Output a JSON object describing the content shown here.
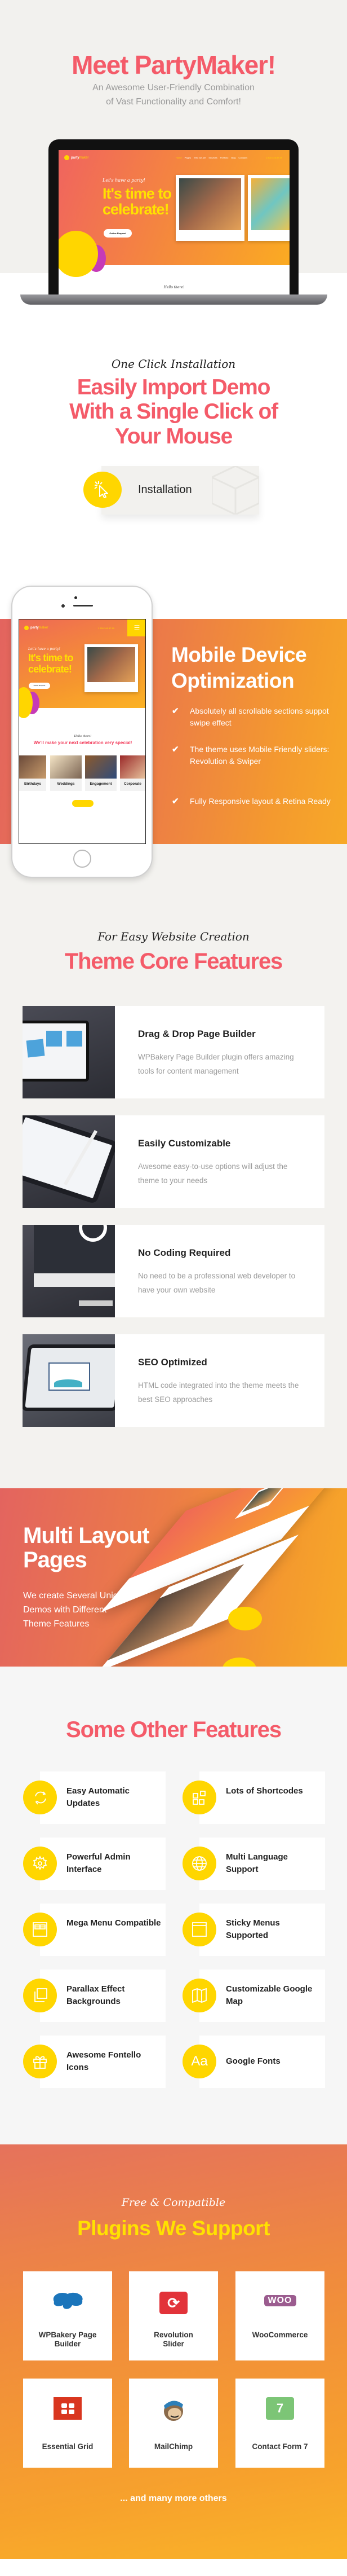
{
  "colors": {
    "coral": "#f45b69",
    "yellow": "#ffd600",
    "orange_start": "#e3645f",
    "orange_end": "#f7a928",
    "hero_bg": "#f2f1ee"
  },
  "hero": {
    "title": "Meet PartyMaker!",
    "subtitle_line1": "An Awesome User-Friendly Combination",
    "subtitle_line2": "of Vast Functionality  and Comfort!",
    "mockup": {
      "logo_a": "party",
      "logo_b": "maker",
      "nav": [
        "Home",
        "Pages",
        "Who we are",
        "Services",
        "Portfolio",
        "Blog",
        "Contacts"
      ],
      "phone": "1 800 345 87 89",
      "script": "Let's have a party!",
      "headline_1": "It's time to",
      "headline_2": "celebrate!",
      "cta": "Online Request",
      "hello": "Hello there!"
    }
  },
  "install": {
    "script": "One Click Installation",
    "heading_1": "Easily Import Demo",
    "heading_2": "With a Single Click of",
    "heading_3": "Your Mouse",
    "button_label": "Installation",
    "icon": "cursor-click-icon"
  },
  "mobile": {
    "heading_1": "Mobile Device",
    "heading_2": "Optimization",
    "bullets": [
      "Absolutely all scrollable sections suppot swipe effect",
      "The theme uses Mobile Friendly sliders: Revolution & Swiper",
      "Fully Responsive layout & Retina Ready"
    ],
    "mockup": {
      "phone": "1 800 345 87 89",
      "intro": "We'll make your next celebration very special!",
      "categories": [
        "Birthdays",
        "Weddings",
        "Engagement",
        "Corporate"
      ]
    }
  },
  "core": {
    "script": "For Easy Website Creation",
    "heading": "Theme Core Features",
    "cards": [
      {
        "title": "Drag & Drop Page  Builder",
        "desc": "WPBakery Page Builder plugin offers amazing tools for content management",
        "image": "laptop-widgets"
      },
      {
        "title": "Easily Customizable",
        "desc": "Awesome easy-to-use options will adjust the theme to your needs",
        "image": "tablet-pencil"
      },
      {
        "title": "No Coding Required",
        "desc": "No need to be a professional web developer to have your own website",
        "image": "imac-code"
      },
      {
        "title": "SEO Optimized",
        "desc": "HTML code integrated into the theme meets the best SEO approaches",
        "image": "ipad-seo"
      }
    ]
  },
  "multi": {
    "heading_1": "Multi Layout",
    "heading_2": "Pages",
    "desc_1": "We create Several Unique",
    "desc_2": "Demos with Different",
    "desc_3": "Theme Features"
  },
  "other": {
    "heading": "Some Other Features",
    "items": [
      {
        "label": "Easy Automatic Updates",
        "icon": "refresh-icon"
      },
      {
        "label": "Lots of Shortcodes",
        "icon": "blocks-icon"
      },
      {
        "label": "Powerful Admin Interface",
        "icon": "gear-icon"
      },
      {
        "label": "Multi Language Support",
        "icon": "globe-icon"
      },
      {
        "label": "Mega Menu Compatible",
        "icon": "mega-menu-icon"
      },
      {
        "label": "Sticky Menus Supported",
        "icon": "window-icon"
      },
      {
        "label": "Parallax Effect Backgrounds",
        "icon": "layers-icon"
      },
      {
        "label": "Customizable Google Map",
        "icon": "map-icon"
      },
      {
        "label": "Awesome Fontello Icons",
        "icon": "gift-icon"
      },
      {
        "label": "Google Fonts",
        "icon": "font-icon",
        "glyph": "Aa"
      }
    ]
  },
  "plugins": {
    "script": "Free & Compatible",
    "heading": "Plugins We Support",
    "items": [
      {
        "label": "WPBakery Page Builder",
        "icon": "wpbakery-logo-icon"
      },
      {
        "label": "Revolution Slider",
        "icon": "revslider-logo-icon"
      },
      {
        "label": "WooCommerce",
        "icon": "woo-logo-icon",
        "logo_text": "WOO"
      },
      {
        "label": "Essential Grid",
        "icon": "essential-grid-logo-icon"
      },
      {
        "label": "MailChimp",
        "icon": "mailchimp-logo-icon"
      },
      {
        "label": "Contact Form 7",
        "icon": "cf7-logo-icon",
        "logo_text": "7"
      }
    ],
    "more": "... and many more others"
  }
}
